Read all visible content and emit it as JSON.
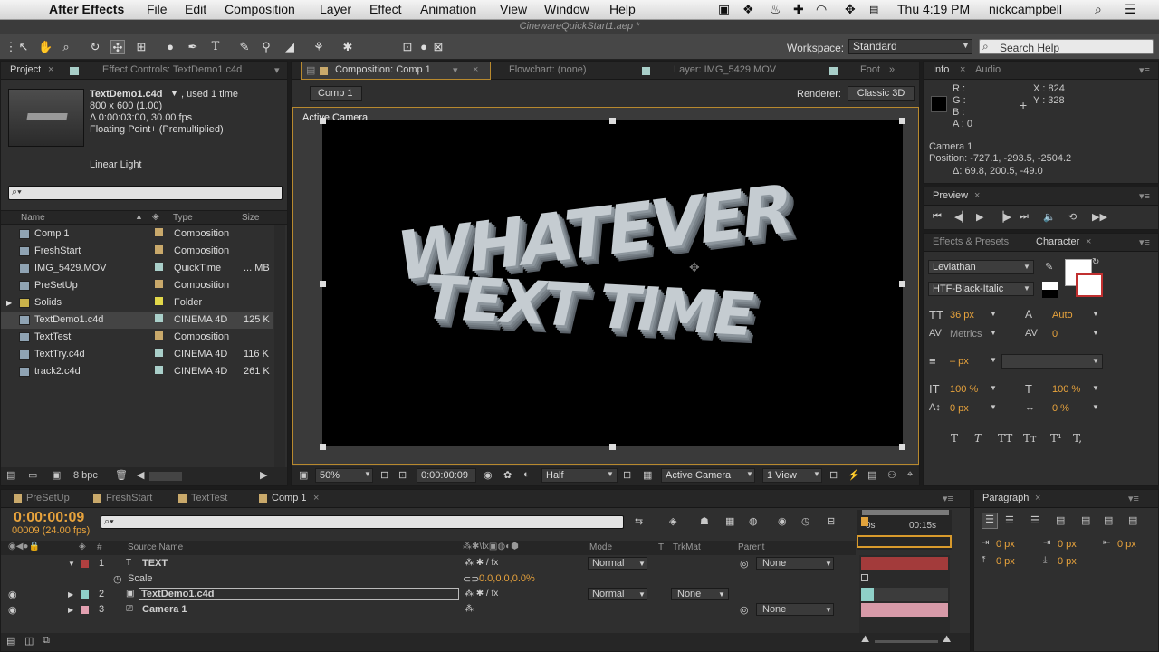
{
  "menubar": {
    "app_name": "After Effects",
    "items": [
      "File",
      "Edit",
      "Composition",
      "Layer",
      "Effect",
      "Animation",
      "View",
      "Window",
      "Help"
    ],
    "clock": "Thu 4:19 PM",
    "user": "nickcampbell"
  },
  "window_title": "CinewareQuickStart1.aep *",
  "toolbar": {
    "workspace_label": "Workspace:",
    "workspace_value": "Standard",
    "search_placeholder": "Search Help"
  },
  "project_panel": {
    "tabs": [
      "Project",
      "Effect Controls: TextDemo1.c4d"
    ],
    "selected_name": "TextDemo1.c4d",
    "selected_used": ", used 1 time",
    "info_size": "800 x 600 (1.00)",
    "info_duration": "Δ 0:00:03:00, 30.00 fps",
    "info_color": "Floating Point+ (Premultiplied)",
    "info_blend": "Linear Light",
    "columns": {
      "name": "Name",
      "type": "Type",
      "size": "Size"
    },
    "items": [
      {
        "name": "Comp 1",
        "type": "Composition",
        "size": "",
        "label": "#c9a96b"
      },
      {
        "name": "FreshStart",
        "type": "Composition",
        "size": "",
        "label": "#c9a96b"
      },
      {
        "name": "IMG_5429.MOV",
        "type": "QuickTime",
        "size": "... MB",
        "label": "#a9cfc9"
      },
      {
        "name": "PreSetUp",
        "type": "Composition",
        "size": "",
        "label": "#c9a96b"
      },
      {
        "name": "Solids",
        "type": "Folder",
        "size": "",
        "label": "#e2d84a"
      },
      {
        "name": "TextDemo1.c4d",
        "type": "CINEMA 4D",
        "size": "125 K",
        "label": "#a9cfc9"
      },
      {
        "name": "TextTest",
        "type": "Composition",
        "size": "",
        "label": "#c9a96b"
      },
      {
        "name": "TextTry.c4d",
        "type": "CINEMA 4D",
        "size": "116 K",
        "label": "#a9cfc9"
      },
      {
        "name": "track2.c4d",
        "type": "CINEMA 4D",
        "size": "261 K",
        "label": "#a9cfc9"
      }
    ],
    "bpc": "8 bpc"
  },
  "comp_panel": {
    "tabs": [
      "Composition: Comp 1",
      "Flowchart: (none)",
      "Layer: IMG_5429.MOV",
      "Foot"
    ],
    "breadcrumb": "Comp 1",
    "renderer_label": "Renderer:",
    "renderer_value": "Classic 3D",
    "view_label": "Active Camera",
    "text_line1": "WHATEVER",
    "text_line2": "TEXT TIME",
    "zoom": "50%",
    "timecode": "0:00:00:09",
    "resolution": "Half",
    "camera": "Active Camera",
    "views": "1 View"
  },
  "info_panel": {
    "tabs": [
      "Info",
      "Audio"
    ],
    "r": "R :",
    "g": "G :",
    "b": "B :",
    "a": "A : 0",
    "x": "X : 824",
    "y": "Y : 328",
    "camera": "Camera 1",
    "position": "Position: -727.1, -293.5, -2504.2",
    "delta": "Δ: 69.8, 200.5, -49.0"
  },
  "preview_panel": {
    "title": "Preview"
  },
  "character_panel": {
    "tabs": [
      "Effects & Presets",
      "Character"
    ],
    "font": "Leviathan",
    "style": "HTF-Black-Italic",
    "size": "36 px",
    "leading": "Auto",
    "kerning": "Metrics",
    "tracking": "0",
    "stroke": "– px",
    "vscale": "100 %",
    "hscale": "100 %",
    "baseline": "0 px",
    "tsume": "0 %",
    "styles": [
      "T",
      "T",
      "TT",
      "Tт",
      "T¹",
      "T,"
    ]
  },
  "timeline": {
    "tabs": [
      "PreSetUp",
      "FreshStart",
      "TextTest",
      "Comp 1"
    ],
    "timecode": "0:00:00:09",
    "frame_info": "00009 (24.00 fps)",
    "columns": {
      "source": "Source Name",
      "mode": "Mode",
      "t": "T",
      "trkmat": "TrkMat",
      "parent": "Parent"
    },
    "ruler": [
      "0s",
      "00:15s"
    ],
    "layers": [
      {
        "num": "1",
        "name": "TEXT",
        "mode": "Normal",
        "trkmat": "",
        "parent": "None",
        "color": "#b04040"
      },
      {
        "num": "2",
        "name": "TextDemo1.c4d",
        "mode": "Normal",
        "trkmat": "None",
        "parent": "",
        "color": "#8fd0c8"
      },
      {
        "num": "3",
        "name": "Camera 1",
        "mode": "",
        "trkmat": "",
        "parent": "None",
        "color": "#e2a0b0"
      }
    ],
    "scale_label": "Scale",
    "scale_value": "0.0,0.0,0.0%"
  },
  "paragraph_panel": {
    "title": "Paragraph",
    "indent_left": "0 px",
    "indent_first": "0 px",
    "indent_right": "0 px",
    "space_before": "0 px",
    "space_after": "0 px"
  }
}
